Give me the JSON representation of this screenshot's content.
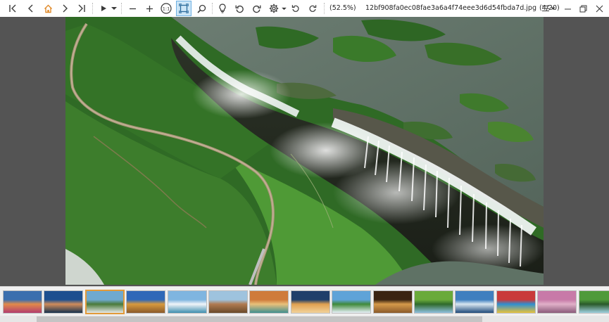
{
  "toolbar": {
    "zoom": "(52.5%)",
    "filename": "12bf908fa0ec08fae3a6a4f74eee3d6d54fbda7d.jpg",
    "position": "(4/20)",
    "icons": [
      "first-image-icon",
      "previous-image-icon",
      "home-icon",
      "next-image-icon",
      "last-image-icon",
      "play-slideshow-icon",
      "dropdown-icon",
      "zoom-out-icon",
      "zoom-in-icon",
      "actual-size-icon",
      "fit-to-window-icon",
      "magnifier-icon",
      "bulb-icon",
      "rotate-left-icon",
      "rotate-right-icon",
      "gear-icon",
      "undo-icon",
      "redo-icon",
      "hamburger-menu-icon",
      "minimize-icon",
      "restore-icon",
      "close-icon"
    ],
    "actual_size_label": "1:1"
  },
  "viewer": {
    "image": "victoria-falls-aerial-photo"
  },
  "filmstrip": {
    "current_index": 3,
    "thumbnails": [
      {
        "name": "thumb-1",
        "colors": [
          "#3b6fae",
          "#e28a4a",
          "#b23d6e"
        ]
      },
      {
        "name": "thumb-2",
        "colors": [
          "#1d4f8f",
          "#d08c5b",
          "#16324f"
        ]
      },
      {
        "name": "thumb-3",
        "colors": [
          "#6fa9cf",
          "#4a7a3a",
          "#e8e8e8"
        ]
      },
      {
        "name": "thumb-4",
        "colors": [
          "#2f68b8",
          "#d89a3d",
          "#8a5a2a"
        ]
      },
      {
        "name": "thumb-5",
        "colors": [
          "#7fb5e0",
          "#f0f4f8",
          "#3e8fb0"
        ]
      },
      {
        "name": "thumb-6",
        "colors": [
          "#9ec3de",
          "#b07a50",
          "#6a4a2a"
        ]
      },
      {
        "name": "thumb-7",
        "colors": [
          "#cf7b3b",
          "#e9c07a",
          "#3f8f8f"
        ]
      },
      {
        "name": "thumb-8",
        "colors": [
          "#1f3f6a",
          "#e0a050",
          "#f2d29a"
        ]
      },
      {
        "name": "thumb-9",
        "colors": [
          "#5fa3d8",
          "#3f8a3a",
          "#e8f0f8"
        ]
      },
      {
        "name": "thumb-10",
        "colors": [
          "#3a2412",
          "#d69a4a",
          "#8a5a2a"
        ]
      },
      {
        "name": "thumb-11",
        "colors": [
          "#6aaa3a",
          "#2f6a2a",
          "#8fc0e0"
        ]
      },
      {
        "name": "thumb-12",
        "colors": [
          "#3f7fbf",
          "#d8e6f0",
          "#1f4a7a"
        ]
      },
      {
        "name": "thumb-13",
        "colors": [
          "#c93a3a",
          "#2f8fd0",
          "#e8c23a"
        ]
      },
      {
        "name": "thumb-14",
        "colors": [
          "#c87aa8",
          "#e0b0c8",
          "#8a5a7a"
        ]
      },
      {
        "name": "thumb-15",
        "colors": [
          "#4f9a3a",
          "#2a5a2a",
          "#9fd0e0"
        ]
      }
    ]
  }
}
